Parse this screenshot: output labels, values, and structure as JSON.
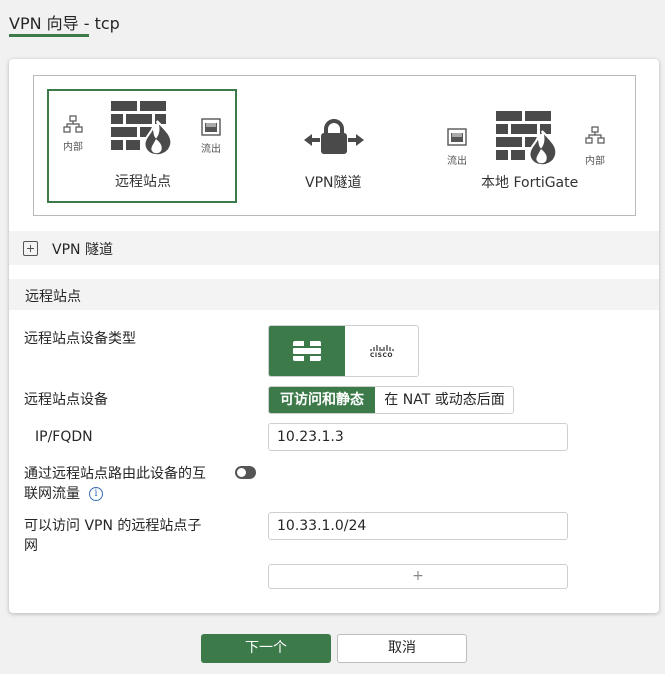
{
  "header": {
    "title": "VPN 向导 - tcp"
  },
  "topology": {
    "remote_site_label": "远程站点",
    "remote_internal_label": "内部",
    "remote_outgoing_label": "流出",
    "tunnel_label": "VPN隧道",
    "local_label": "本地 FortiGate",
    "local_outgoing_label": "流出",
    "local_internal_label": "内部"
  },
  "tunnel_section": {
    "label": "VPN 隧道"
  },
  "remote_section": {
    "label": "远程站点"
  },
  "form": {
    "device_type_label": "远程站点设备类型",
    "device_label": "远程站点设备",
    "device_options": [
      "可访问和静态",
      "在 NAT 或动态后面"
    ],
    "ipfqdn_label": "IP/FQDN",
    "ipfqdn_value": "10.23.1.3",
    "route_label_line1": "通过远程站点路由此设备的互",
    "route_label_line2": "联网流量",
    "subnet_label_line1": "可以访问 VPN 的远程站点子",
    "subnet_label_line2": "网",
    "subnet_value": "10.33.1.0/24",
    "add_symbol": "+",
    "cisco_text": "CISCO",
    "info_symbol": "i"
  },
  "footer": {
    "next_label": "下一个",
    "cancel_label": "取消"
  },
  "colors": {
    "accent": "#3c7a4a",
    "icon_gray": "#4a4a4a"
  }
}
